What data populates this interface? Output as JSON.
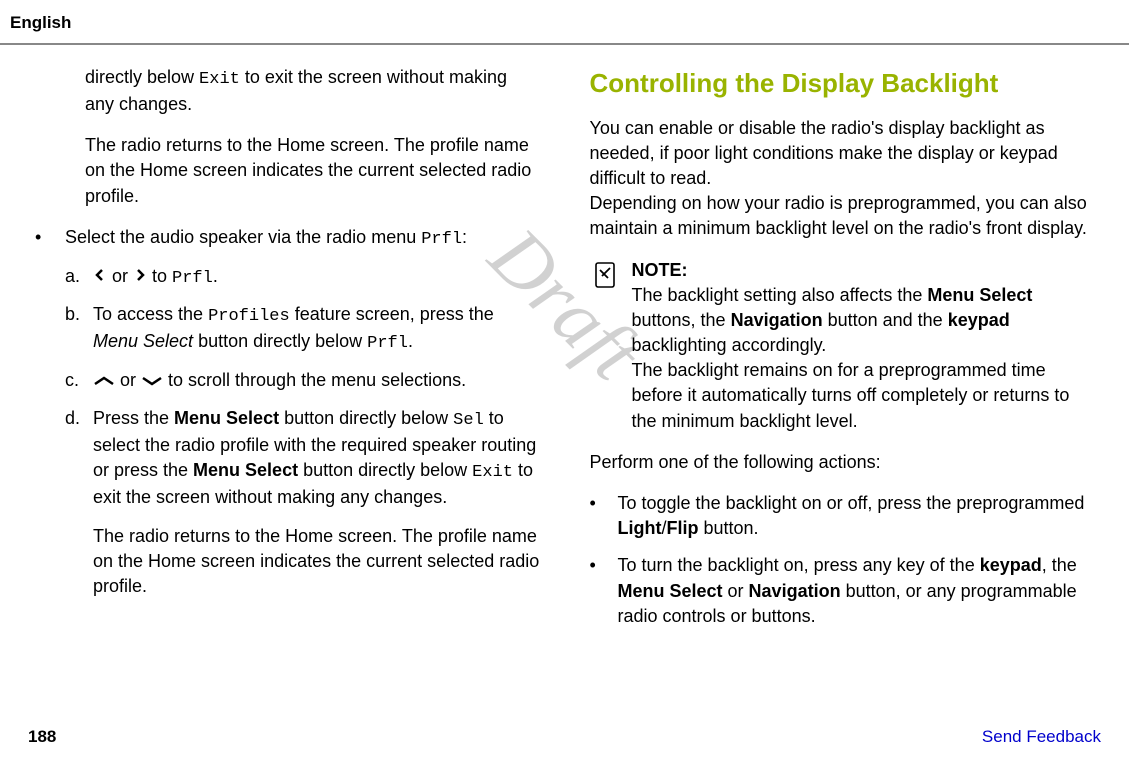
{
  "header": {
    "language": "English"
  },
  "watermark": "Draft",
  "left": {
    "p1a": "directly below ",
    "p1_mono": "Exit",
    "p1b": " to exit the screen without making any changes.",
    "p2": "The radio returns to the Home screen. The profile name on the Home screen indicates the current selected radio profile.",
    "bullet_text_a": "Select the audio speaker via the radio menu ",
    "bullet_mono": "Prfl",
    "bullet_text_b": ":",
    "a": {
      "label": "a.",
      "mid": " or ",
      "end_a": " to ",
      "end_mono": "Prfl",
      "end_b": "."
    },
    "b": {
      "label": "b.",
      "t1": "To access the ",
      "mono1": "Profiles",
      "t2": " feature screen, press the ",
      "ital": "Menu Select",
      "t3": " button directly below ",
      "mono2": "Prfl",
      "t4": "."
    },
    "c": {
      "label": "c.",
      "mid": " or ",
      "end": " to scroll through the menu selections."
    },
    "d": {
      "label": "d.",
      "t1": "Press the ",
      "b1": "Menu Select",
      "t2": " button directly below ",
      "mono1": "Sel",
      "t3": " to select the radio profile with the required speaker routing or press the ",
      "b2": "Menu Select",
      "t4": " button directly below ",
      "mono2": "Exit",
      "t5": " to exit the screen without making any changes."
    },
    "p3": "The radio returns to the Home screen. The profile name on the Home screen indicates the current selected radio profile."
  },
  "right": {
    "heading": "Controlling the Display Backlight",
    "p1": "You can enable or disable the radio's display backlight as needed, if poor light conditions make the display or keypad difficult to read.",
    "p2": "Depending on how your radio is preprogrammed, you can also maintain a minimum backlight level on the radio's front display.",
    "note": {
      "title": "NOTE:",
      "t1": "The backlight setting also affects the ",
      "b1": "Menu Select",
      "t2": " buttons, the ",
      "b2": "Navigation",
      "t3": " button and the ",
      "b3": "keypad",
      "t4": " backlighting accordingly.",
      "t5": "The backlight remains on for a preprogrammed time before it automatically turns off completely or returns to the minimum backlight level."
    },
    "perform": "Perform one of the following actions:",
    "bul1": {
      "t1": "To toggle the backlight on or off, press the preprogrammed ",
      "b1": "Light",
      "t2": "/",
      "b2": "Flip",
      "t3": " button."
    },
    "bul2": {
      "t1": "To turn the backlight on, press any key of the ",
      "b1": "keypad",
      "t2": ", the ",
      "b2": "Menu Select",
      "t3": " or ",
      "b3": "Navigation",
      "t4": " button, or any programmable radio controls or buttons."
    }
  },
  "footer": {
    "page": "188",
    "feedback": "Send Feedback"
  }
}
